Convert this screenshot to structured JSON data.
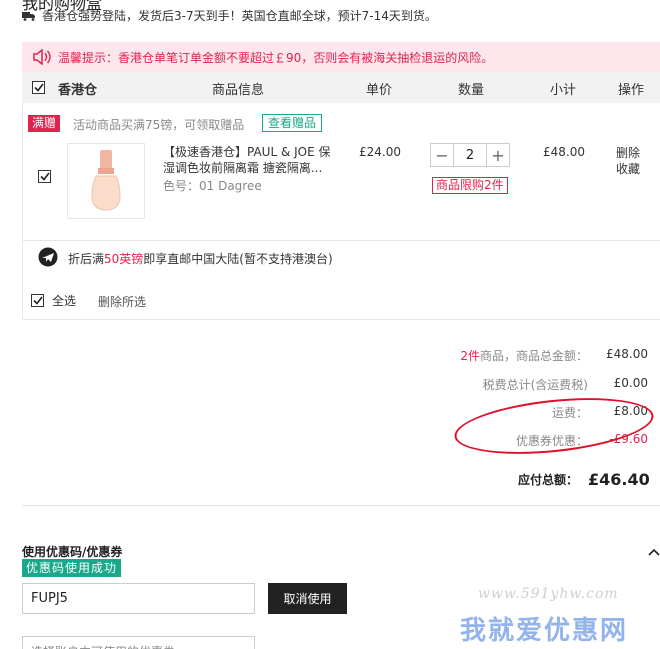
{
  "page": {
    "title": "我的购物盒",
    "ship_note": "香港仓强势登陆，发货后3-7天到手！英国仓直邮全球，预计7-14天到货。"
  },
  "warning": {
    "text": "温馨提示：香港仓单笔订单金额不要超过￡90，否则会有被海关抽检退运的风险。"
  },
  "table": {
    "warehouse": "香港仓",
    "headers": {
      "product": "商品信息",
      "unit_price": "单价",
      "quantity": "数量",
      "subtotal": "小计",
      "action": "操作"
    }
  },
  "promo": {
    "tag": "满赠",
    "text": "活动商品买满75镑，可领取赠品",
    "link": "查看赠品"
  },
  "item": {
    "name_line1": "【极速香港仓】PAUL & JOE 保",
    "name_line2": "湿调色妆前隔离霜 搪瓷隔离...",
    "variant": "色号：01 Dagree",
    "price": "£24.00",
    "qty": "2",
    "qty_minus": "−",
    "qty_plus": "+",
    "limit": "商品限购2件",
    "subtotal": "£48.00",
    "delete": "删除",
    "favorite": "收藏"
  },
  "shipping": {
    "prefix": "折后满",
    "highlight": "50英镑",
    "suffix": "即享直邮中国大陆(暂不支持港澳台)"
  },
  "footer_actions": {
    "select_all": "全选",
    "delete_selected": "删除所选"
  },
  "summary": {
    "item_count": "2件",
    "items_label": "商品，商品总金额：",
    "items_total": "£48.00",
    "tax_label": "税费总计(含运费税)",
    "tax": "£0.00",
    "freight_label": "运费：",
    "freight": "£8.00",
    "coupon_label": "优惠券优惠：",
    "coupon": "-£9.60",
    "total_label": "应付总额：",
    "total": "£46.40"
  },
  "coupon": {
    "title": "使用优惠码/优惠券",
    "success": "优惠码使用成功",
    "code": "FUPJ5",
    "cancel": "取消使用",
    "select_placeholder": "选择账户中可使用的优惠券"
  },
  "watermark": {
    "url": "www.591yhw.com",
    "text": "我就爱优惠网"
  },
  "colors": {
    "accent": "#e0234e",
    "green": "#19a88a",
    "annotation": "#e0102a"
  }
}
